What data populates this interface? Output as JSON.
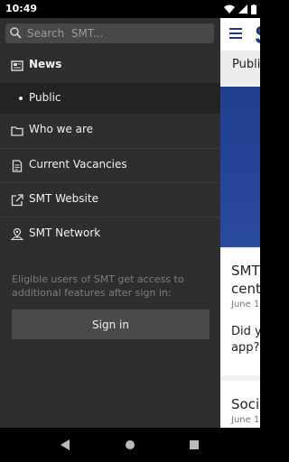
{
  "status": {
    "time": "10:49"
  },
  "search": {
    "placeholder": "Search  SMT..."
  },
  "drawer": {
    "items": [
      {
        "label": "News",
        "icon": "news-icon"
      },
      {
        "label": "Public",
        "icon": "bullet"
      },
      {
        "label": "Who we are",
        "icon": "folder-icon"
      },
      {
        "label": "Current Vacancies",
        "icon": "document-icon"
      },
      {
        "label": "SMT Website",
        "icon": "external-link-icon"
      },
      {
        "label": "SMT Network",
        "icon": "map-pin-icon"
      }
    ],
    "signin_note": "Eligible users of SMT get access to additional features after sign in:",
    "signin_button": "Sign in"
  },
  "main": {
    "logo_fragment": "S",
    "tab_label": "Publi",
    "cards": [
      {
        "title_line1": "SMT",
        "title_line2": "cent",
        "date": "June 1",
        "text_line1": "Did yo",
        "text_line2": "app?"
      },
      {
        "title_line1": "Socia",
        "date": "June 1"
      }
    ]
  },
  "colors": {
    "drawer_bg": "#2e2e2e",
    "brand": "#1e3a7a",
    "hero": "#2a4aa0"
  }
}
